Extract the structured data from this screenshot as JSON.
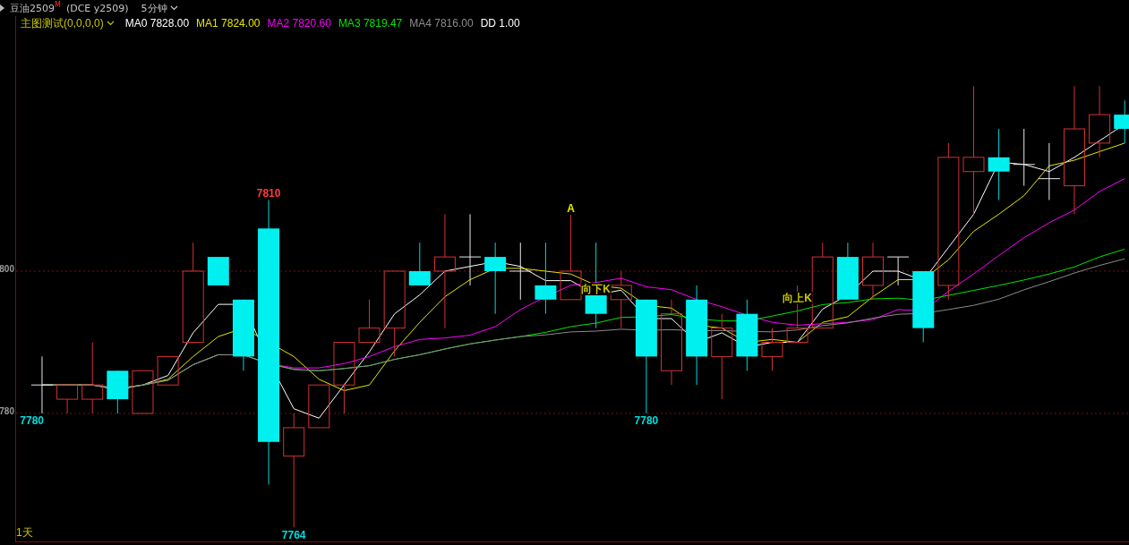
{
  "title_bar": {
    "symbol": "豆油2509$^{M}$",
    "exchange": "(DCE y2509)",
    "period": "5分钟"
  },
  "indicator_legend": {
    "name": "主图测试(0,0,0,0)",
    "items": [
      {
        "kind": "ma",
        "label": "MA0 7828.00",
        "color": "#ffffff"
      },
      {
        "kind": "ma",
        "label": "MA1 7824.00",
        "color": "#e6e600"
      },
      {
        "kind": "ma",
        "label": "MA2 7820.60",
        "color": "#ff00ff"
      },
      {
        "kind": "ma",
        "label": "MA3 7819.47",
        "color": "#00e600"
      },
      {
        "kind": "ma",
        "label": "MA4 7816.00",
        "color": "#8c8c8c"
      },
      {
        "kind": "value",
        "label": "DD 1.00",
        "color": "#ffffff"
      }
    ]
  },
  "chart": {
    "axis_labels": [
      "800",
      "780"
    ],
    "annotations": [
      {
        "text": "7810",
        "color": "#ff3c3c"
      },
      {
        "text": "7764",
        "color": "#00dede"
      },
      {
        "text": "7780",
        "color": "#00dede"
      },
      {
        "text": "7780",
        "color": "#00dede"
      },
      {
        "text": "A",
        "color": "#e6e600"
      },
      {
        "text": "向下K",
        "color": "#c8c800"
      },
      {
        "text": "向上K",
        "color": "#c8c800"
      }
    ]
  },
  "range_label": "1天"
}
